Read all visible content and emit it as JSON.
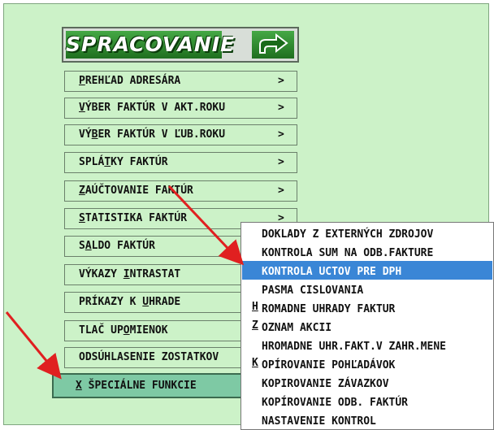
{
  "header": {
    "title": "SPRACOVANIE",
    "arrow_icon": "arrow-right-icon"
  },
  "menu": [
    {
      "pre": "",
      "u": "P",
      "post": "REHĽAD ADRESÁRA",
      "chev": ">"
    },
    {
      "pre": "",
      "u": "V",
      "post": "ÝBER FAKTÚR V AKT.ROKU",
      "chev": ">"
    },
    {
      "pre": "VÝ",
      "u": "B",
      "post": "ER FAKTÚR V ĽUB.ROKU",
      "chev": ">"
    },
    {
      "pre": "SPLÁ",
      "u": "T",
      "post": "KY FAKTÚR",
      "chev": ">"
    },
    {
      "pre": "",
      "u": "Z",
      "post": "AÚČTOVANIE FAKTÚR",
      "chev": ">"
    },
    {
      "pre": "",
      "u": "S",
      "post": "TATISTIKA FAKTÚR",
      "chev": ">"
    },
    {
      "pre": "S",
      "u": "A",
      "post": "LDO FAKTÚR",
      "chev": ""
    },
    {
      "pre": "VÝKAZY ",
      "u": "I",
      "post": "NTRASTAT",
      "chev": ""
    },
    {
      "pre": "PRÍKAZY K ",
      "u": "U",
      "post": "HRADE",
      "chev": ""
    },
    {
      "pre": "TLAČ UP",
      "u": "O",
      "post": "MIENOK",
      "chev": ""
    },
    {
      "pre": "ODSÚHLASENIE ZOSTATKOV",
      "u": "",
      "post": "",
      "chev": ""
    },
    {
      "pre": "",
      "u": "X",
      "post": " ŠPECIÁLNE FUNKCIE",
      "chev": ""
    }
  ],
  "submenu": [
    {
      "pre": "DOKLADY Z EXTERNÝCH ZDROJOV",
      "u": "",
      "post": ""
    },
    {
      "pre": "KONTROLA SUM NA ODB.FAKTURE",
      "u": "",
      "post": ""
    },
    {
      "pre": "KONTROLA UCTOV PRE DPH",
      "u": "",
      "post": ""
    },
    {
      "pre": "PASMA CISLOVANIA",
      "u": "",
      "post": ""
    },
    {
      "pre": "",
      "u": "H",
      "post": "ROMADNE UHRADY FAKTUR"
    },
    {
      "pre": "",
      "u": "Z",
      "post": "OZNAM AKCII"
    },
    {
      "pre": "HROMADNE UHR.FAKT.V ZAHR.MENE",
      "u": "",
      "post": ""
    },
    {
      "pre": "",
      "u": "K",
      "post": "OPÍROVANIE POHĽADÁVOK"
    },
    {
      "pre": "KOPIROVANIE ZÁVAZKOV",
      "u": "",
      "post": ""
    },
    {
      "pre": "KOPÍROVANIE ODB. FAKTÚR",
      "u": "",
      "post": ""
    },
    {
      "pre": "NASTAVENIE KONTROL",
      "u": "",
      "post": ""
    }
  ],
  "colors": {
    "highlight": "#3a86d6",
    "annotation": "#e02020",
    "panel": "#ccf2c8"
  }
}
